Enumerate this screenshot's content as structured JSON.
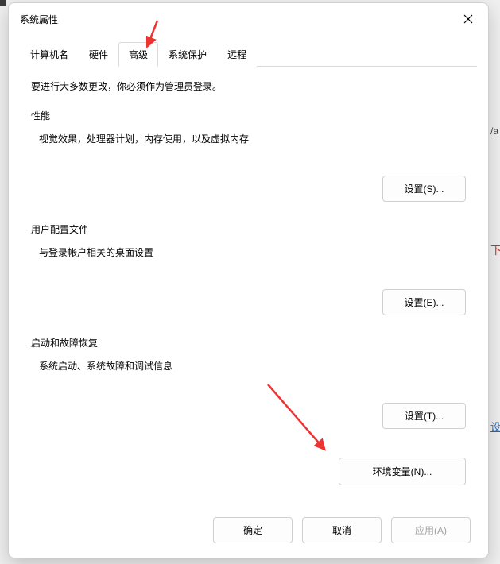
{
  "window": {
    "title": "系统属性"
  },
  "tabs": [
    {
      "label": "计算机名"
    },
    {
      "label": "硬件"
    },
    {
      "label": "高级"
    },
    {
      "label": "系统保护"
    },
    {
      "label": "远程"
    }
  ],
  "note": "要进行大多数更改，你必须作为管理员登录。",
  "groups": {
    "perf": {
      "title": "性能",
      "desc": "视觉效果，处理器计划，内存使用，以及虚拟内存",
      "button": "设置(S)..."
    },
    "profiles": {
      "title": "用户配置文件",
      "desc": "与登录帐户相关的桌面设置",
      "button": "设置(E)..."
    },
    "startup": {
      "title": "启动和故障恢复",
      "desc": "系统启动、系统故障和调试信息",
      "button": "设置(T)..."
    }
  },
  "env_button": "环境变量(N)...",
  "footer": {
    "ok": "确定",
    "cancel": "取消",
    "apply": "应用(A)"
  }
}
